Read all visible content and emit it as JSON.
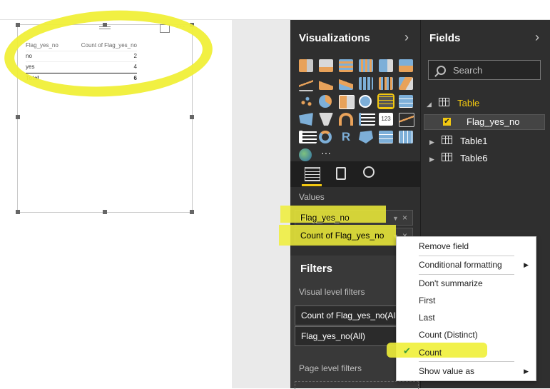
{
  "visual_table": {
    "headers": [
      "Flag_yes_no",
      "Count of Flag_yes_no"
    ],
    "rows": [
      {
        "label": "no",
        "value": "2"
      },
      {
        "label": "yes",
        "value": "4"
      }
    ],
    "total": {
      "label": "Total",
      "value": "6"
    },
    "more_label": "···"
  },
  "visualizations": {
    "title": "Visualizations",
    "chevron": "›",
    "values_label": "Values",
    "wells": [
      "Flag_yes_no",
      "Count of Flag_yes_no"
    ],
    "remove_glyph": "×",
    "filters_title": "Filters",
    "visual_level_filters_label": "Visual level filters",
    "filters": [
      "Count of Flag_yes_no(All)",
      "Flag_yes_no(All)"
    ],
    "page_level_filters_label": "Page level filters"
  },
  "fields": {
    "title": "Fields",
    "chevron": "›",
    "search_placeholder": "Search",
    "tables": [
      {
        "name": "Table",
        "expanded": true,
        "fields": [
          {
            "name": "Flag_yes_no",
            "checked": true
          }
        ]
      },
      {
        "name": "Table1",
        "expanded": false
      },
      {
        "name": "Table6",
        "expanded": false
      }
    ]
  },
  "context_menu": {
    "items": [
      {
        "label": "Remove field"
      },
      {
        "label": "Conditional formatting",
        "submenu": true
      },
      {
        "label": "Don't summarize"
      },
      {
        "label": "First"
      },
      {
        "label": "Last"
      },
      {
        "label": "Count (Distinct)"
      },
      {
        "label": "Count",
        "checked": true
      },
      {
        "label": "Show value as",
        "submenu": true
      }
    ],
    "submenu_arrow": "▶",
    "check_glyph": "✔"
  },
  "colors": {
    "highlight": "#f0ef38",
    "accent": "#f2c811",
    "pane_bg": "#2f2f2f"
  },
  "viz_icons": [
    "stacked-bar-icon",
    "stacked-column-icon",
    "clustered-bar-icon",
    "clustered-column-icon",
    "100-bar-icon",
    "100-column-icon",
    "line-icon",
    "area-icon",
    "stacked-area-icon",
    "line-column-icon",
    "line-clustered-icon",
    "ribbon-icon",
    "scatter-icon",
    "pie-icon",
    "treemap-icon",
    "map-icon",
    "table-icon",
    "matrix-icon",
    "filled-map-icon",
    "funnel-icon",
    "gauge-icon",
    "multirow-card-icon",
    "card-icon",
    "kpi-icon",
    "slicer-icon",
    "donut-icon",
    "r-visual-icon",
    "shape-map-icon",
    "table2-icon",
    "matrix2-icon",
    "globe-icon",
    "more-visuals-icon"
  ]
}
